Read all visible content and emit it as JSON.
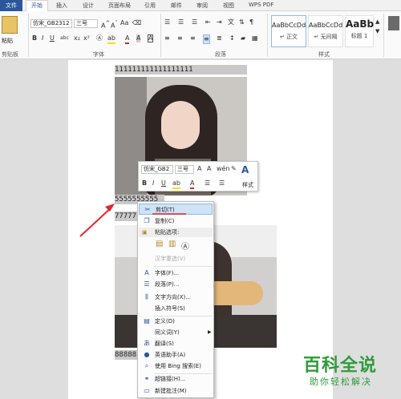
{
  "ribbon": {
    "file_tab": "文件",
    "tabs": [
      "开始",
      "插入",
      "设计",
      "页面布局",
      "引用",
      "邮件",
      "审阅",
      "视图",
      "WPS PDF"
    ],
    "paste_label": "粘贴",
    "font_name": "仿宋_GB2312",
    "font_size": "三号",
    "groups": {
      "clipboard": "剪贴板",
      "font": "字体",
      "paragraph": "段落",
      "styles": "样式"
    },
    "styles": [
      {
        "sample": "AaBbCcDd",
        "name": "↵ 正文"
      },
      {
        "sample": "AaBbCcDd",
        "name": "↵ 无间隔"
      },
      {
        "sample": "AaBb",
        "name": "标题 1"
      }
    ]
  },
  "document": {
    "row_1": "111111111111111111",
    "row_5": "5555555555",
    "row_7": "77777",
    "row_8": "88888"
  },
  "mini_toolbar": {
    "font_name": "仿宋_GB2",
    "font_size": "三号",
    "styles_label": "样式"
  },
  "context_menu": {
    "cut": "剪切(T)",
    "copy": "复制(C)",
    "paste_options": "粘贴选项:",
    "hanzi": "汉字重选(V)",
    "font": "字体(F)...",
    "paragraph": "段落(P)...",
    "text_direction": "文字方向(X)...",
    "insert_symbol": "插入符号(S)",
    "define": "定义(D)",
    "synonyms": "同义词(Y)",
    "translate": "翻译(S)",
    "english_assistant": "英语助手(A)",
    "bing_search": "使用 Bing 搜索(E)",
    "hyperlink": "超链接(H)...",
    "new_comment": "新建批注(M)"
  },
  "watermark": {
    "title": "百科全说",
    "subtitle": "助你轻松解决"
  },
  "colors": {
    "accent": "#2b579a",
    "highlight": "#cfe3f7",
    "annotation": "#e0262b",
    "watermark": "#2e9c3a"
  }
}
